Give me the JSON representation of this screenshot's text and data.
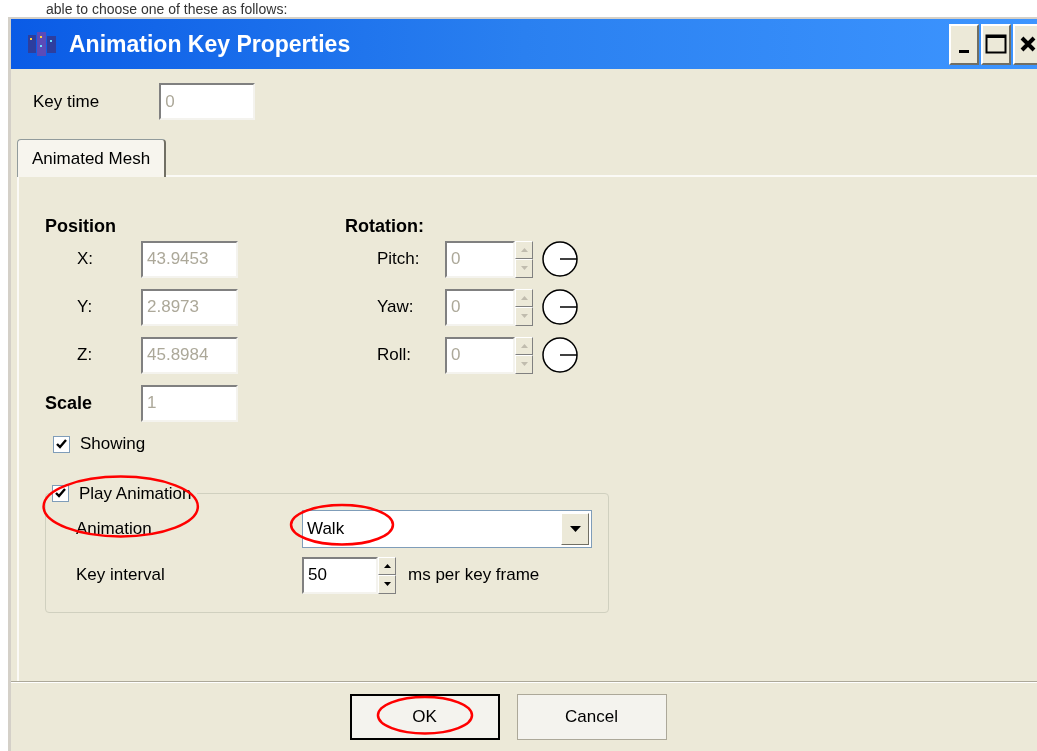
{
  "top_text": "able to choose one of these as follows:",
  "window": {
    "title": "Animation Key Properties"
  },
  "key_time": {
    "label": "Key time",
    "value": "0",
    "disabled": true
  },
  "tabs": [
    {
      "label": "Animated Mesh",
      "selected": true
    }
  ],
  "position": {
    "heading": "Position",
    "fields": [
      {
        "label": "X:",
        "value": "43.9453",
        "disabled": true
      },
      {
        "label": "Y:",
        "value": "2.8973",
        "disabled": true
      },
      {
        "label": "Z:",
        "value": "45.8984",
        "disabled": true
      }
    ]
  },
  "rotation": {
    "heading": "Rotation:",
    "fields": [
      {
        "label": "Pitch:",
        "value": "0",
        "disabled": true
      },
      {
        "label": "Yaw:",
        "value": "0",
        "disabled": true
      },
      {
        "label": "Roll:",
        "value": "0",
        "disabled": true
      }
    ]
  },
  "scale": {
    "label": "Scale",
    "value": "1",
    "disabled": true
  },
  "showing": {
    "label": "Showing",
    "checked": true
  },
  "play_animation": {
    "label": "Play Animation",
    "checked": true,
    "circled": true,
    "animation": {
      "label": "Animation",
      "value": "Walk",
      "circled": true
    },
    "key_interval": {
      "label": "Key interval",
      "value": "50",
      "unit": "ms per key frame"
    }
  },
  "buttons": [
    {
      "label": "OK",
      "default": true,
      "circled": true
    },
    {
      "label": "Cancel",
      "default": false,
      "circled": false
    }
  ]
}
